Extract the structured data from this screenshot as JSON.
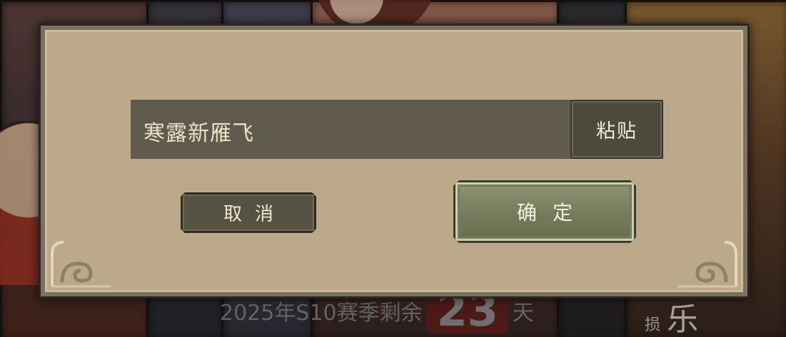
{
  "background": {
    "season_text": "2025年S10赛季剩余",
    "season_days": "23",
    "season_unit": "天",
    "badge_small": "损",
    "badge_big": "乐"
  },
  "dialog": {
    "input_value": "寒露新雁飞",
    "paste_label": "粘贴",
    "cancel_label": "取消",
    "confirm_label": "确定"
  },
  "colors": {
    "dialog_bg": "#bba98a",
    "input_bg": "#5f5a4b",
    "button_dark": "#555243",
    "button_confirm": "#767b5c",
    "text_light": "#efe7d2"
  }
}
